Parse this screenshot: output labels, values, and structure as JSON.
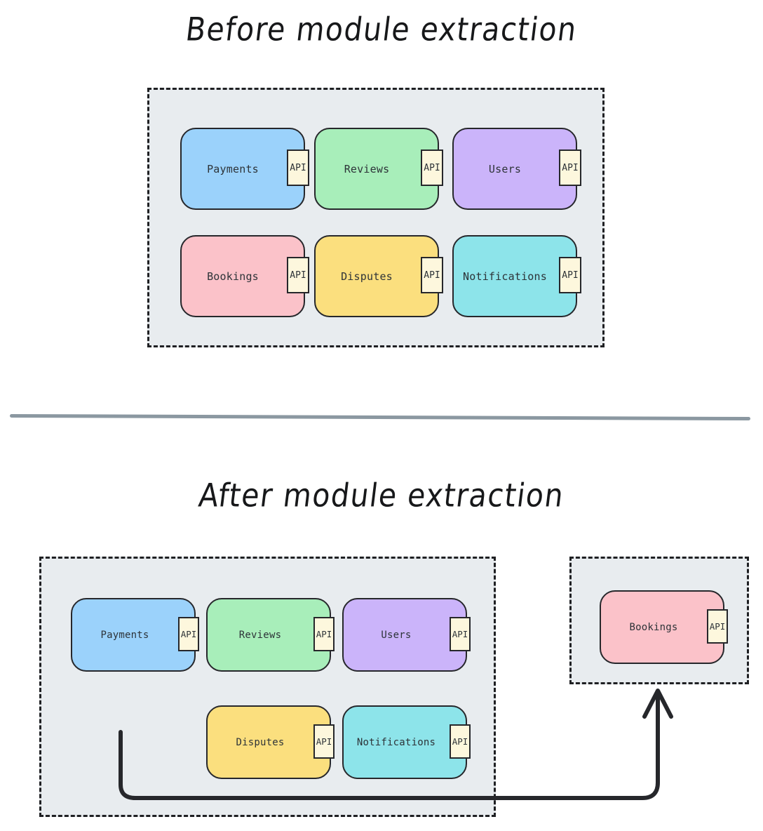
{
  "page": {
    "background_color": "#ffffff",
    "divider_color": "#8b98a1"
  },
  "palette": {
    "container_fill": "#e8ecef",
    "container_border": "#1f2023",
    "module_border": "#26272b",
    "api_fill": "#fdf7dd",
    "label_color": "#2d3338",
    "arrow_color": "#26272b",
    "blue": "#9bd2fb",
    "green": "#a8eeba",
    "purple": "#cbb4fa",
    "pink": "#fbc2c9",
    "yellow": "#fbdf7e",
    "cyan": "#8de4ea"
  },
  "sections": [
    {
      "id": "before",
      "title": "Before module extraction",
      "containers": [
        {
          "id": "before-monolith",
          "name": "monolith-container",
          "modules": [
            {
              "label": "Payments",
              "api_label": "API",
              "color": "#9bd2fb"
            },
            {
              "label": "Reviews",
              "api_label": "API",
              "color": "#a8eeba"
            },
            {
              "label": "Users",
              "api_label": "API",
              "color": "#cbb4fa"
            },
            {
              "label": "Bookings",
              "api_label": "API",
              "color": "#fbc2c9"
            },
            {
              "label": "Disputes",
              "api_label": "API",
              "color": "#fbdf7e"
            },
            {
              "label": "Notifications",
              "api_label": "API",
              "color": "#8de4ea"
            }
          ]
        }
      ]
    },
    {
      "id": "after",
      "title": "After module extraction",
      "containers": [
        {
          "id": "after-monolith",
          "name": "remaining-monolith-container",
          "modules": [
            {
              "label": "Payments",
              "api_label": "API",
              "color": "#9bd2fb"
            },
            {
              "label": "Reviews",
              "api_label": "API",
              "color": "#a8eeba"
            },
            {
              "label": "Users",
              "api_label": "API",
              "color": "#cbb4fa"
            },
            {
              "label": "Disputes",
              "api_label": "API",
              "color": "#fbdf7e"
            },
            {
              "label": "Notifications",
              "api_label": "API",
              "color": "#8de4ea"
            }
          ]
        },
        {
          "id": "after-extracted",
          "name": "extracted-service-container",
          "modules": [
            {
              "label": "Bookings",
              "api_label": "API",
              "color": "#fbc2c9"
            }
          ]
        }
      ]
    }
  ],
  "arrow": {
    "name": "extraction-arrow",
    "from": "remaining-monolith-container",
    "to": "extracted-service-container"
  }
}
